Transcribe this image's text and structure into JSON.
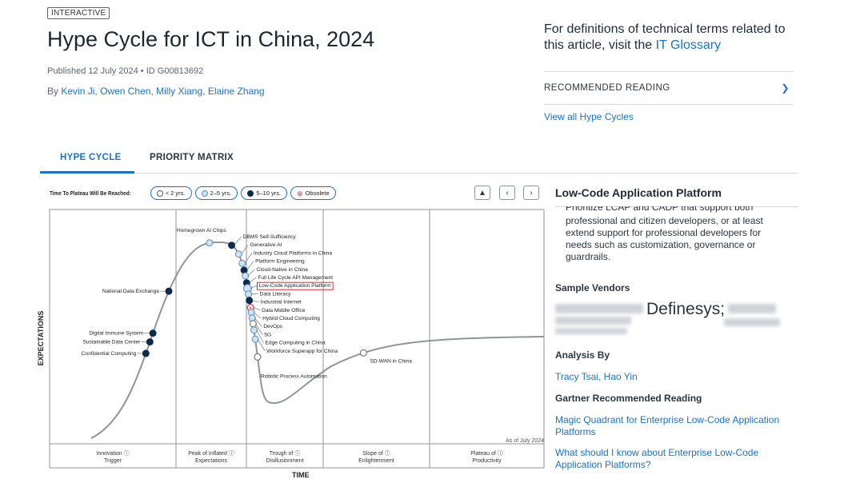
{
  "header": {
    "badge": "INTERACTIVE",
    "title": "Hype Cycle for ICT in China, 2024",
    "published": "Published 12 July 2024 • ID G00813692",
    "by": "By",
    "authors": [
      "Kevin Ji",
      "Owen Chen",
      "Milly Xiang",
      "Elaine Zhang"
    ],
    "definitions_text": "For definitions of technical terms related to this article, visit the",
    "glossary_link": "IT Glossary",
    "recommended_reading": "RECOMMENDED READING",
    "view_all": "View all Hype Cycles"
  },
  "tabs": [
    {
      "label": "HYPE CYCLE",
      "active": true
    },
    {
      "label": "PRIORITY MATRIX",
      "active": false
    }
  ],
  "legend": {
    "title": "Time To Plateau Will Be Reached:",
    "items": [
      {
        "label": "< 2 yrs.",
        "icon": "white-circle",
        "color": "#ffffff"
      },
      {
        "label": "2–5 yrs.",
        "icon": "light-blue-circle",
        "color": "#cfe3f3"
      },
      {
        "label": "5–10 yrs.",
        "icon": "navy-circle",
        "color": "#0e2a4d"
      },
      {
        "label": "Obsolete",
        "icon": "red-x-circle",
        "color": "#e8303a"
      }
    ]
  },
  "colors": {
    "accent": "#1a73c8",
    "navy": "#0e2a4d",
    "light": "#cfe3f3",
    "obsolete": "#e8303a",
    "highlight_box": "#d32f2f"
  },
  "chart_data": {
    "type": "scatter",
    "y_label": "EXPECTATIONS",
    "x_label": "TIME",
    "as_of": "As of July 2024",
    "phases": [
      "Innovation Trigger",
      "Peak of Inflated Expectations",
      "Trough of Disillusionment",
      "Slope of Enlightenment",
      "Plateau of Productivity"
    ],
    "phase_lines": [
      "Innovation",
      "Trigger",
      "Peak of Inflated",
      "Expectations",
      "Trough of",
      "Disillusionment",
      "Slope of",
      "Enlightenment",
      "Plateau of",
      "Productivity"
    ],
    "selected": "Low-Code Application Platform",
    "points": [
      {
        "name": "National Data Exchange",
        "status": "5-10",
        "t": 0.238
      },
      {
        "name": "Digital Immune System",
        "status": "5-10",
        "t": 0.175
      },
      {
        "name": "Sustainable Data Center",
        "status": "5-10",
        "t": 0.162
      },
      {
        "name": "Confidential Computing",
        "status": "5-10",
        "t": 0.145
      },
      {
        "name": "Homegrown AI Chips",
        "status": "2-5",
        "t": 0.33
      },
      {
        "name": "DBMS Self-Sufficiency",
        "status": "5-10",
        "t": 0.362
      },
      {
        "name": "Generative AI",
        "status": "2-5",
        "t": 0.378
      },
      {
        "name": "Industry Cloud Platforms in China",
        "status": "2-5",
        "t": 0.392
      },
      {
        "name": "Platform Engineering",
        "status": "5-10",
        "t": 0.402
      },
      {
        "name": "Cloud-Native in China",
        "status": "2-5",
        "t": 0.41
      },
      {
        "name": "Full Life Cycle API Management",
        "status": "5-10",
        "t": 0.42
      },
      {
        "name": "Low-Code Application Platform",
        "status": "2-5",
        "t": 0.428
      },
      {
        "name": "Data Literacy",
        "status": "2-5",
        "t": 0.436
      },
      {
        "name": "Industrial Internet",
        "status": "5-10",
        "t": 0.445
      },
      {
        "name": "Data Middle Office",
        "status": "obsolete",
        "t": 0.455
      },
      {
        "name": "Hybrid Cloud Computing",
        "status": "2-5",
        "t": 0.462
      },
      {
        "name": "DevOps",
        "status": "2-5",
        "t": 0.47
      },
      {
        "name": "5G",
        "status": "<2",
        "t": 0.478
      },
      {
        "name": "Edge Computing in China",
        "status": "2-5",
        "t": 0.487
      },
      {
        "name": "Workforce Superapp for China",
        "status": "2-5",
        "t": 0.5
      },
      {
        "name": "Robotic Process Automation",
        "status": "<2",
        "t": 0.525
      },
      {
        "name": "SD-WAN in China",
        "status": "<2",
        "t": 0.745
      }
    ]
  },
  "side": {
    "title": "Low-Code Application Platform",
    "cut_line": "Prioritize LCAP and CADP that support both",
    "paragraph": "professional and citizen developers, or at least extend support for professional developers for needs such as customization, governance or guardrails.",
    "sample_vendors": "Sample Vendors",
    "vendor_visible": "Definesys;",
    "analysis_by": "Analysis By",
    "analysts": "Tracy Tsai, Hao Yin",
    "gartner_reading": "Gartner Recommended Reading",
    "link1": "Magic Quadrant for Enterprise Low-Code Application Platforms",
    "link2": "What should I know about Enterprise Low-Code Application Platforms?"
  }
}
